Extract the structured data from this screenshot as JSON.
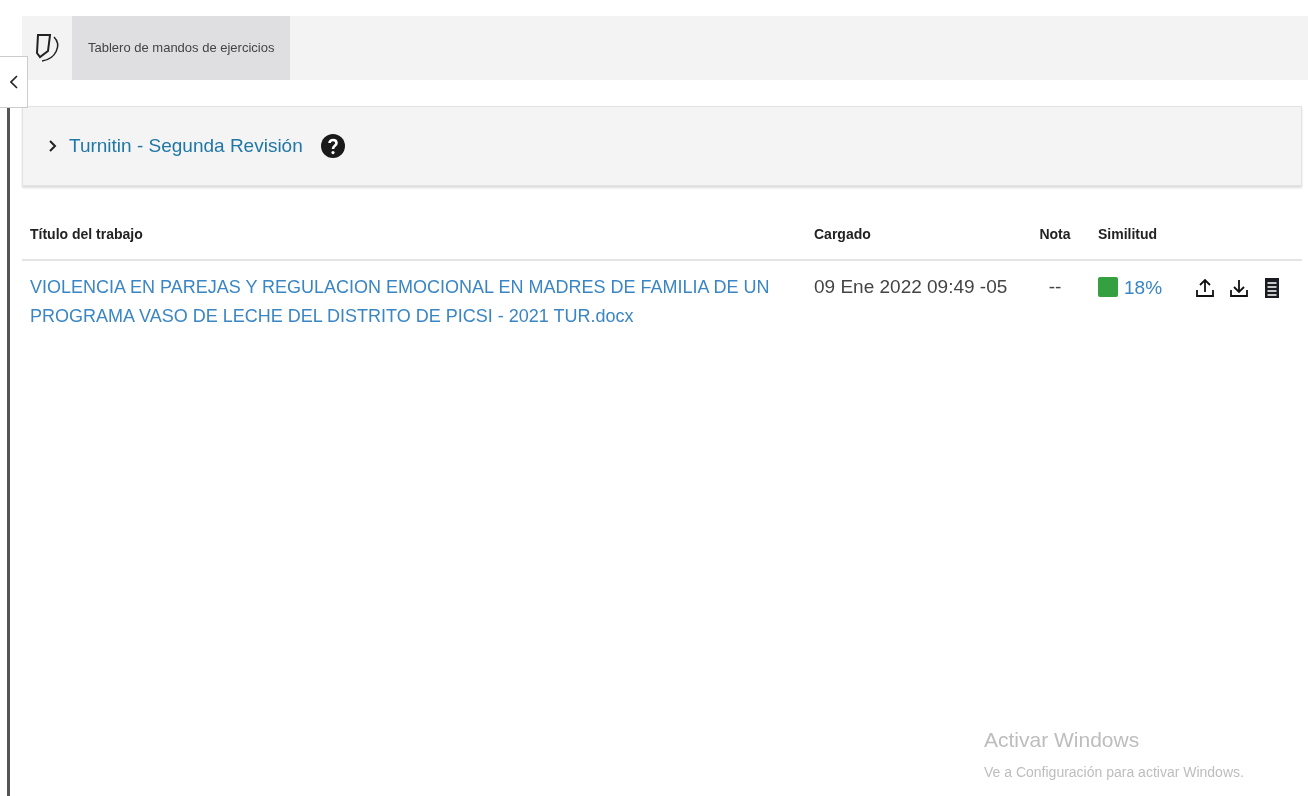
{
  "header": {
    "tabs": [
      {
        "label": "Tablero de mandos de ejercicios",
        "selected": true
      }
    ]
  },
  "assignment": {
    "title": "Turnitin - Segunda Revisión",
    "expanded": false
  },
  "table": {
    "columns": [
      "Título del trabajo",
      "Cargado",
      "Nota",
      "Similitud"
    ],
    "rows": [
      {
        "title": "VIOLENCIA EN PAREJAS Y REGULACION EMOCIONAL EN MADRES DE FAMILIA DE UN PROGRAMA VASO DE LECHE DEL DISTRITO DE PICSI - 2021 TUR.docx",
        "uploaded": "09 Ene 2022 09:49 -05",
        "grade": "--",
        "similarity": "18%"
      }
    ]
  },
  "activation_notice": {
    "title": "Activar Windows",
    "message": "Ve a Configuración para activar Windows."
  }
}
